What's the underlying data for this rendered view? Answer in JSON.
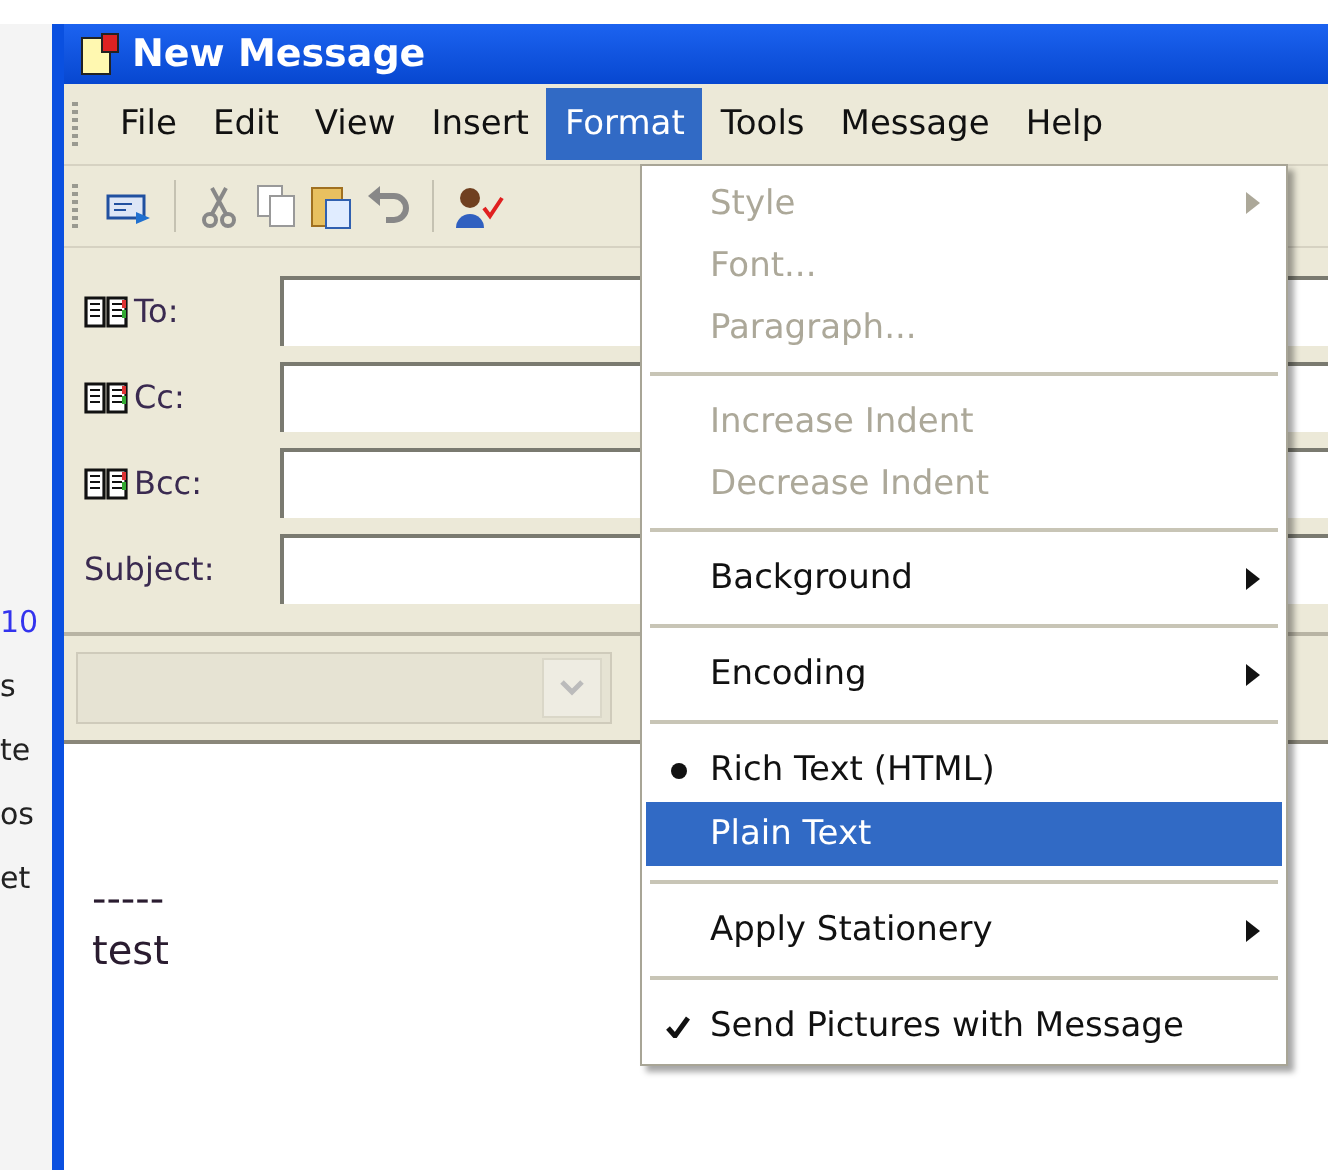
{
  "background_window": {
    "fragments": [
      "10",
      "s",
      "te",
      "os",
      "et"
    ]
  },
  "window": {
    "title": "New Message"
  },
  "menu_bar": [
    {
      "label": "File",
      "selected": false
    },
    {
      "label": "Edit",
      "selected": false
    },
    {
      "label": "View",
      "selected": false
    },
    {
      "label": "Insert",
      "selected": false
    },
    {
      "label": "Format",
      "selected": true
    },
    {
      "label": "Tools",
      "selected": false
    },
    {
      "label": "Message",
      "selected": false
    },
    {
      "label": "Help",
      "selected": false
    }
  ],
  "header_fields": [
    {
      "label": "To:",
      "address_book": true
    },
    {
      "label": "Cc:",
      "address_book": true
    },
    {
      "label": "Bcc:",
      "address_book": true
    },
    {
      "label": "Subject:",
      "address_book": false
    }
  ],
  "body": {
    "lines": [
      "-----",
      "test"
    ]
  },
  "format_menu": [
    {
      "kind": "item",
      "label": "Style",
      "disabled": true,
      "submenu": true,
      "bullet": false,
      "checked": false,
      "selected": false
    },
    {
      "kind": "item",
      "label": "Font...",
      "disabled": true,
      "submenu": false,
      "bullet": false,
      "checked": false,
      "selected": false
    },
    {
      "kind": "item",
      "label": "Paragraph...",
      "disabled": true,
      "submenu": false,
      "bullet": false,
      "checked": false,
      "selected": false
    },
    {
      "kind": "separator"
    },
    {
      "kind": "item",
      "label": "Increase Indent",
      "disabled": true,
      "submenu": false,
      "bullet": false,
      "checked": false,
      "selected": false
    },
    {
      "kind": "item",
      "label": "Decrease Indent",
      "disabled": true,
      "submenu": false,
      "bullet": false,
      "checked": false,
      "selected": false
    },
    {
      "kind": "separator"
    },
    {
      "kind": "item",
      "label": "Background",
      "disabled": false,
      "submenu": true,
      "bullet": false,
      "checked": false,
      "selected": false
    },
    {
      "kind": "separator"
    },
    {
      "kind": "item",
      "label": "Encoding",
      "disabled": false,
      "submenu": true,
      "bullet": false,
      "checked": false,
      "selected": false
    },
    {
      "kind": "separator"
    },
    {
      "kind": "item",
      "label": "Rich Text (HTML)",
      "disabled": false,
      "submenu": false,
      "bullet": true,
      "checked": false,
      "selected": false
    },
    {
      "kind": "item",
      "label": "Plain Text",
      "disabled": false,
      "submenu": false,
      "bullet": false,
      "checked": false,
      "selected": true
    },
    {
      "kind": "separator"
    },
    {
      "kind": "item",
      "label": "Apply Stationery",
      "disabled": false,
      "submenu": true,
      "bullet": false,
      "checked": false,
      "selected": false
    },
    {
      "kind": "separator"
    },
    {
      "kind": "item",
      "label": "Send Pictures with Message",
      "disabled": false,
      "submenu": false,
      "bullet": false,
      "checked": true,
      "selected": false
    }
  ]
}
